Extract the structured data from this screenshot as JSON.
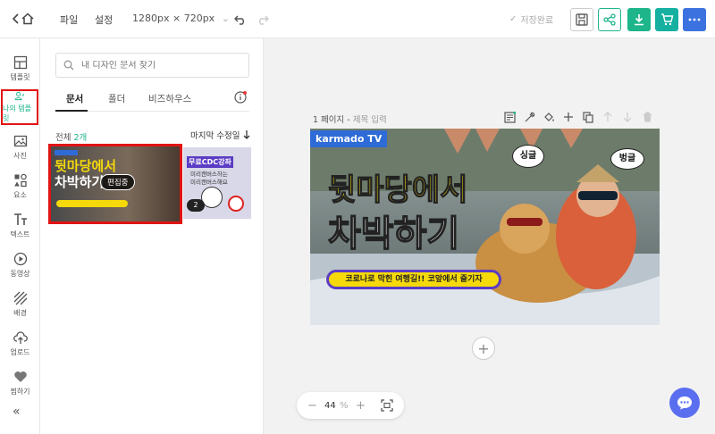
{
  "header": {
    "menu_file": "파일",
    "menu_settings": "설정",
    "canvas_size": "1280px × 720px",
    "save_status": "저장완료"
  },
  "sidebar": {
    "items": [
      {
        "label": "템플릿"
      },
      {
        "label": "나의 템플릿"
      },
      {
        "label": "사진"
      },
      {
        "label": "요소"
      },
      {
        "label": "텍스트"
      },
      {
        "label": "동영상"
      },
      {
        "label": "배경"
      },
      {
        "label": "업로드"
      },
      {
        "label": "찜하기"
      }
    ],
    "collapse_label": "«"
  },
  "panel": {
    "search_placeholder": "내 디자인 문서 찾기",
    "tabs": [
      "문서",
      "폴더",
      "비즈하우스"
    ],
    "count_prefix": "전체",
    "count_value": "2개",
    "sort_label": "마지막 수정일",
    "doc1_badge": "편집중",
    "doc1_text_a": "뒷마당에서",
    "doc1_text_b": "차박하기",
    "doc2_badge": "2",
    "doc2_text_a": "무료CDC강좌",
    "doc2_text_b": "미리캔버스하는",
    "doc2_text_c": "미리캔버스해요"
  },
  "canvas": {
    "page_label": "1 페이지 - ",
    "page_title": "제목 입력",
    "zoom_value": "44",
    "zoom_unit": "%",
    "zoom_minus": "−",
    "zoom_plus": "+",
    "add_page": "+"
  },
  "design": {
    "brand": "karmado TV",
    "headline_1": "뒷마당에서",
    "headline_2": "차박하기",
    "subtitle": "코로나로 막힌 여행길!! 코앞에서 즐기자",
    "bubble_1": "싱글",
    "bubble_2": "벙글"
  },
  "colors": {
    "accent_green": "#1eb58b",
    "highlight_red": "#e01414",
    "headline_yellow": "#f5d90a",
    "chat_blue": "#5a6ff0"
  }
}
